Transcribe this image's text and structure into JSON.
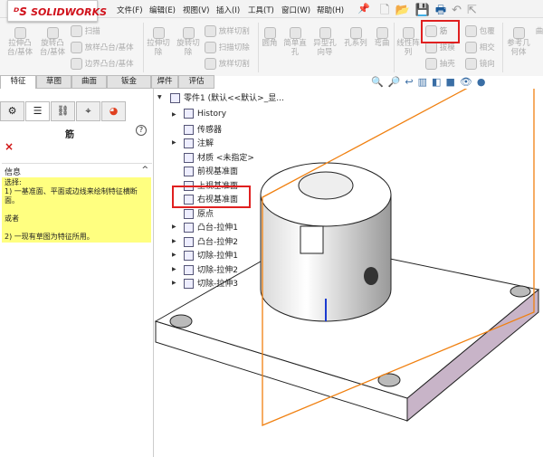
{
  "app": {
    "logo": "SOLIDWORKS"
  },
  "menu": [
    "文件(F)",
    "编辑(E)",
    "视图(V)",
    "插入(I)",
    "工具(T)",
    "窗口(W)",
    "帮助(H)"
  ],
  "ribbon": {
    "items": [
      "拉伸凸台/基体",
      "旋转凸台/基体",
      "扫描",
      "放样凸台/基体",
      "边界凸台/基体",
      "拉伸切除",
      "旋转切除",
      "放样切割",
      "扫描切除",
      "放样切割",
      "圆角",
      "简单直孔",
      "异型孔向导",
      "孔系列",
      "弯曲",
      "线性阵列",
      "筋",
      "包覆",
      "拔模",
      "相交",
      "抽壳",
      "镜向",
      "参考几何体",
      "曲"
    ]
  },
  "tabs": [
    "特征",
    "草图",
    "曲面",
    "钣金",
    "焊件",
    "评估"
  ],
  "panel": {
    "title": "筋",
    "help": "?",
    "close": "×",
    "section": "信息",
    "collapse": "^",
    "message": [
      "选择:",
      "1) 一基准面、平面或边线来绘制特征横断面。",
      "",
      "或者",
      "",
      "2) 一现有草图为特征所用。"
    ]
  },
  "tree": {
    "root": "零件1 (默认<<默认>_显...",
    "items": [
      "History",
      "传感器",
      "注解",
      "材质 <未指定>",
      "前视基准面",
      "上视基准面",
      "右视基准面",
      "原点",
      "凸台-拉伸1",
      "凸台-拉伸2",
      "切除-拉伸1",
      "切除-拉伸2",
      "切除-拉伸3"
    ]
  },
  "colors": {
    "accent": "#d0111b",
    "highlight": "#e02020",
    "plane": "#f08010",
    "info_bg": "#ffff80",
    "body_side": "#c8b4c8"
  }
}
